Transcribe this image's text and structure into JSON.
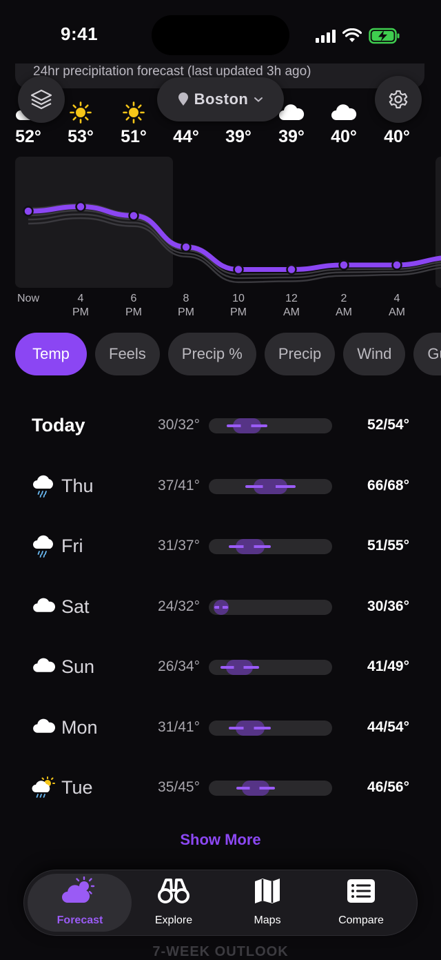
{
  "status_bar": {
    "time": "9:41"
  },
  "precip_banner": {
    "text": "24hr precipitation forecast (last updated 3h ago)"
  },
  "location": {
    "name": "Boston"
  },
  "hourly": [
    {
      "label": "Now",
      "temp": "52°",
      "icon": "cloud-icon"
    },
    {
      "label": "4\nPM",
      "temp": "53°",
      "icon": "sun-icon"
    },
    {
      "label": "6\nPM",
      "temp": "51°",
      "icon": "sun-icon"
    },
    {
      "label": "8\nPM",
      "temp": "44°",
      "icon": "none"
    },
    {
      "label": "10\nPM",
      "temp": "39°",
      "icon": "none"
    },
    {
      "label": "12\nAM",
      "temp": "39°",
      "icon": "cloud-icon"
    },
    {
      "label": "2\nAM",
      "temp": "40°",
      "icon": "cloud-icon"
    },
    {
      "label": "4\nAM",
      "temp": "40°",
      "icon": "none"
    }
  ],
  "chart_data": {
    "type": "line",
    "categories": [
      "Now",
      "4 PM",
      "6 PM",
      "8 PM",
      "10 PM",
      "12 AM",
      "2 AM",
      "4 AM"
    ],
    "values": [
      52,
      53,
      51,
      44,
      39,
      39,
      40,
      40
    ],
    "color": "#8b46f3"
  },
  "tabs": [
    {
      "label": "Temp",
      "active": true
    },
    {
      "label": "Feels",
      "active": false
    },
    {
      "label": "Precip %",
      "active": false
    },
    {
      "label": "Precip",
      "active": false
    },
    {
      "label": "Wind",
      "active": false
    },
    {
      "label": "Gu",
      "active": false
    }
  ],
  "daily": [
    {
      "name": "Today",
      "icon": "none",
      "low": "30/32°",
      "high": "52/54°",
      "range_start": 0.1,
      "range_end": 0.52
    },
    {
      "name": "Thu",
      "icon": "rain-cloud-icon",
      "low": "37/41°",
      "high": "66/68°",
      "range_start": 0.25,
      "range_end": 0.75
    },
    {
      "name": "Fri",
      "icon": "rain-cloud-icon",
      "low": "31/37°",
      "high": "51/55°",
      "range_start": 0.12,
      "range_end": 0.55
    },
    {
      "name": "Sat",
      "icon": "cloud-icon",
      "low": "24/32°",
      "high": "30/36°",
      "range_start": 0.0,
      "range_end": 0.2
    },
    {
      "name": "Sun",
      "icon": "cloud-icon",
      "low": "26/34°",
      "high": "41/49°",
      "range_start": 0.05,
      "range_end": 0.45
    },
    {
      "name": "Mon",
      "icon": "cloud-icon",
      "low": "31/41°",
      "high": "44/54°",
      "range_start": 0.12,
      "range_end": 0.55
    },
    {
      "name": "Tue",
      "icon": "sun-rain-cloud-icon",
      "low": "35/45°",
      "high": "46/56°",
      "range_start": 0.18,
      "range_end": 0.58
    }
  ],
  "show_more": "Show More",
  "outlook_title": "7-WEEK OUTLOOK",
  "nav": [
    {
      "label": "Forecast",
      "icon": "forecast-icon",
      "active": true
    },
    {
      "label": "Explore",
      "icon": "binoculars-icon",
      "active": false
    },
    {
      "label": "Maps",
      "icon": "map-icon",
      "active": false
    },
    {
      "label": "Compare",
      "icon": "compare-icon",
      "active": false
    }
  ],
  "colors": {
    "accent": "#8b46f3",
    "sun": "#f5c518",
    "background": "#0b0a0d"
  }
}
